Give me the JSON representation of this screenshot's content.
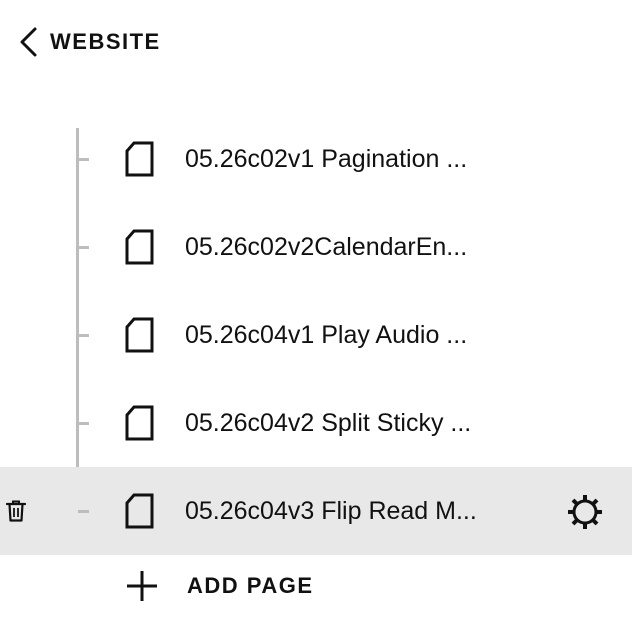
{
  "header": {
    "back_label": "WEBSITE"
  },
  "pages": [
    {
      "title": "05.26c02v1 Pagination ...",
      "icon": "page-icon"
    },
    {
      "title": "05.26c02v2CalendarEn...",
      "icon": "page-icon"
    },
    {
      "title": "05.26c04v1 Play Audio ...",
      "icon": "page-icon"
    },
    {
      "title": "05.26c04v2 Split Sticky ...",
      "icon": "page-icon"
    },
    {
      "title": "05.26c04v3 Flip Read M...",
      "icon": "page-icon",
      "selected": true
    }
  ],
  "row_actions": {
    "delete_icon": "trash-icon",
    "settings_icon": "gear-icon"
  },
  "footer": {
    "add_label": "ADD PAGE",
    "add_icon": "plus-icon"
  },
  "colors": {
    "text": "#111111",
    "tree_line": "#bdbdbd",
    "selected_row": "#e8e8e8",
    "background": "#ffffff"
  }
}
